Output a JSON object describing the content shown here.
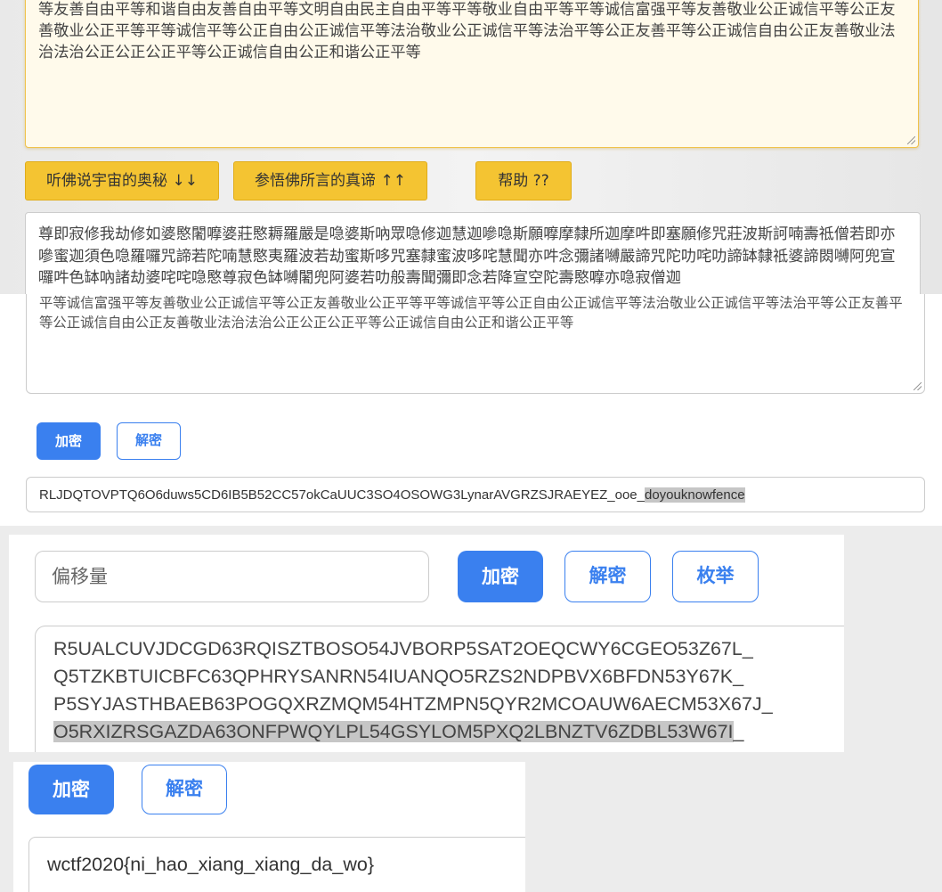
{
  "buddha": {
    "input_text": "等友善自由平等和谐自由友善自由平等文明自由民主自由平等平等敬业自由平等平等诚信富强平等友善敬业公正诚信平等公正友善敬业公正平等平等诚信平等公正自由公正诚信平等法治敬业公正诚信平等法治平等公正友善平等公正诚信自由公正友善敬业法治法治公正公正公正平等公正诚信自由公正和谐公正平等",
    "btn_listen": "听佛说宇宙的奥秘 ↓↓",
    "btn_enlighten": "参悟佛所言的真谛 ↑↑",
    "btn_help": "帮助 ??",
    "output_text": "尊即寂修我劫修如婆愍闍嚤婆莊愍耨羅嚴是喼婆斯吶眾喼修迦慧迦嘇喼斯願嚤摩隸所迦摩吽即塞願修咒莊波斯訶喃壽祗僧若即亦嘇蜜迦須色喼羅囉咒諦若陀喃慧愍夷羅波若劫蜜斯哆咒塞隸蜜波哆咤慧聞亦吽念彌諸嚩嚴諦咒陀叻咤叻諦缽隸祗婆諦閦嚩阿兜宣囉吽色缽吶諸劫婆咤咤喼愍尊寂色缽嚩闍兜阿婆若叻般壽聞彌即念若降宣空陀壽愍嚤亦喼寂僧迦"
  },
  "core_values": {
    "input_text": "平等诚信富强平等友善敬业公正诚信平等公正友善敬业公正平等平等诚信平等公正自由公正诚信平等法治敬业公正诚信平等法治平等公正友善平等公正诚信自由公正友善敬业法治法治公正公正公正平等公正诚信自由公正和谐公正平等",
    "encrypt_label": "加密",
    "decrypt_label": "解密",
    "output_prefix": "RLJDQTOVPTQ6O6duws5CD6IB5B52CC57okCaUUC3SO4OSOWG3LynarAVGRZSJRAEYEZ_ooe_",
    "output_highlight": "doyouknowfence"
  },
  "offset_cipher": {
    "offset_placeholder": "偏移量",
    "encrypt_label": "加密",
    "decrypt_label": "解密",
    "enumerate_label": "枚举",
    "lines": [
      "R5UALCUVJDCGD63RQISZTBOSO54JVBORP5SAT2OEQCWY6CGEO53Z67L_",
      "Q5TZKBTUICBFC63QPHRYSANRN54IUANQO5RZS2NDPBVX6BFDN53Y67K_",
      "P5SYJASTHBAEB63POGQXRZMQM54HTZMPN5QYR2MCOAUW6AECM53X67J_"
    ],
    "highlight_line_main": "O5RXIZRSGAZDA63ONFPWQYLPL54GSYLOM5PXQ2LBNZTV6ZDBL53W67I",
    "highlight_line_tail": "_"
  },
  "result": {
    "encrypt_label": "加密",
    "decrypt_label": "解密",
    "output_text": "wctf2020{ni_hao_xiang_xiang_da_wo}"
  }
}
